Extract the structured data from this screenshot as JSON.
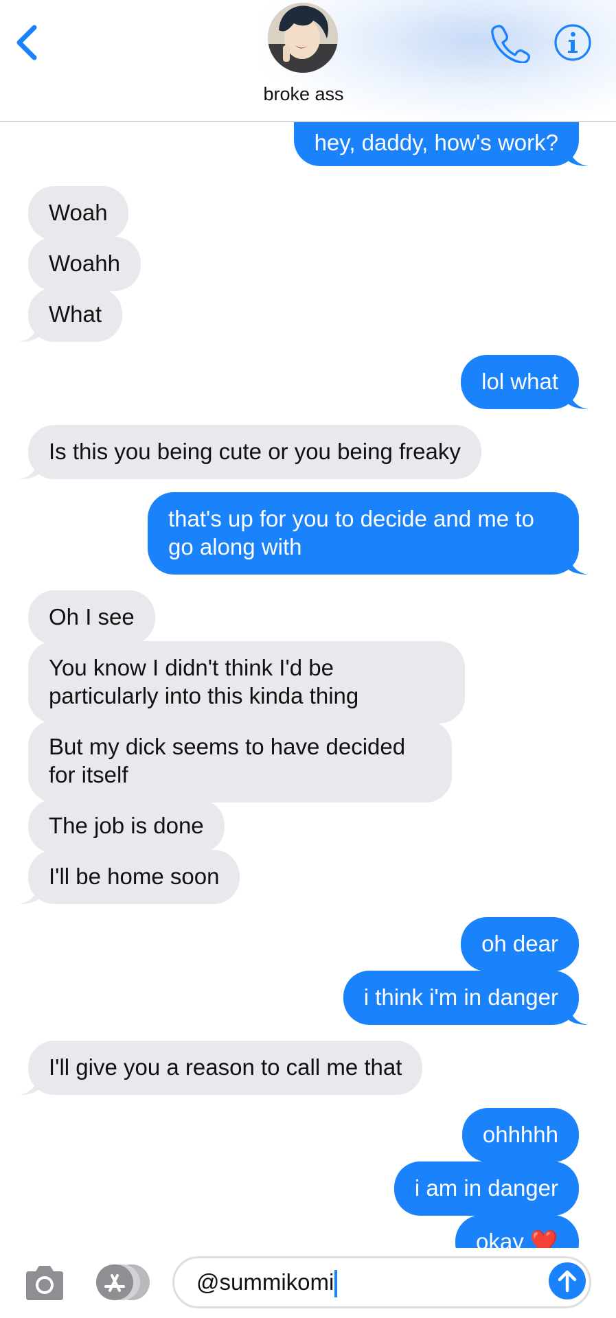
{
  "header": {
    "contact_name": "broke ass",
    "back_icon": "chevron-left-icon",
    "call_icon": "phone-icon",
    "info_icon": "info-icon",
    "accent": "#1a82fb"
  },
  "messages": [
    {
      "dir": "out",
      "text": "hey, daddy, how's work?"
    },
    {
      "dir": "in",
      "text": "Woah"
    },
    {
      "dir": "in",
      "text": "Woahh"
    },
    {
      "dir": "in",
      "text": "What"
    },
    {
      "dir": "out",
      "text": "lol what"
    },
    {
      "dir": "in",
      "text": "Is this you being cute or you being freaky"
    },
    {
      "dir": "out",
      "text": "that's up for you to decide and me to go along with"
    },
    {
      "dir": "in",
      "text": "Oh I see"
    },
    {
      "dir": "in",
      "text": "You know I didn't think I'd be particularly into this kinda thing"
    },
    {
      "dir": "in",
      "text": "But my dick seems to have decided for itself"
    },
    {
      "dir": "in",
      "text": "The job is done"
    },
    {
      "dir": "in",
      "text": "I'll be home soon"
    },
    {
      "dir": "out",
      "text": "oh dear"
    },
    {
      "dir": "out",
      "text": "i think i'm in danger"
    },
    {
      "dir": "in",
      "text": "I'll give you a reason to call me that"
    },
    {
      "dir": "out",
      "text": "ohhhhh"
    },
    {
      "dir": "out",
      "text": "i am in danger"
    },
    {
      "dir": "out",
      "text": "okay ❤️"
    }
  ],
  "input_bar": {
    "text_value": "@summikomi",
    "camera_icon": "camera-icon",
    "apps_icon": "app-store-icon",
    "send_icon": "send-arrow-up-icon"
  },
  "colors": {
    "outgoing_bubble": "#1a82fb",
    "incoming_bubble": "#e8e8ed"
  }
}
